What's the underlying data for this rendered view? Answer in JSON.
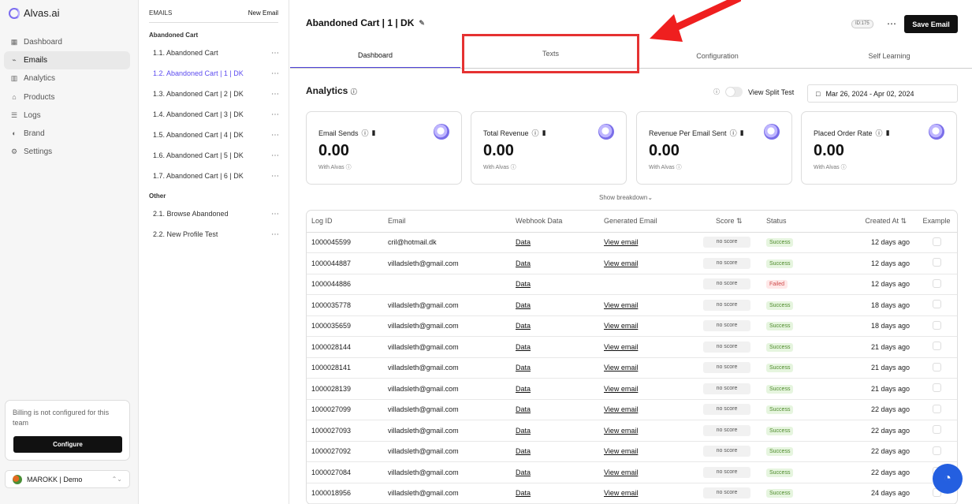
{
  "app": {
    "name": "Alvas.ai"
  },
  "sidebar": {
    "items": [
      {
        "label": "Dashboard",
        "icon": "dashboard-icon"
      },
      {
        "label": "Emails",
        "icon": "emails-icon",
        "active": true
      },
      {
        "label": "Analytics",
        "icon": "analytics-icon"
      },
      {
        "label": "Products",
        "icon": "products-icon"
      },
      {
        "label": "Logs",
        "icon": "logs-icon"
      },
      {
        "label": "Brand",
        "icon": "brand-icon"
      },
      {
        "label": "Settings",
        "icon": "settings-icon"
      }
    ],
    "billing_text": "Billing is not configured for this team",
    "configure_label": "Configure",
    "team": "MAROKK | Demo"
  },
  "emails_panel": {
    "title": "EMAILS",
    "new_label": "New Email",
    "groups": [
      {
        "label": "Abandoned Cart"
      },
      {
        "label": "Other"
      }
    ],
    "items": [
      "1.1. Abandoned Cart",
      "1.2. Abandoned Cart | 1 | DK",
      "1.3. Abandoned Cart | 2 | DK",
      "1.4. Abandoned Cart | 3 | DK",
      "1.5. Abandoned Cart | 4 | DK",
      "1.6. Abandoned Cart | 5 | DK",
      "1.7. Abandoned Cart | 6 | DK",
      "2.1. Browse Abandoned",
      "2.2. New Profile Test"
    ]
  },
  "main": {
    "title": "Abandoned Cart | 1 | DK",
    "id_badge": "ID:175",
    "save_label": "Save Email",
    "tabs": [
      "Dashboard",
      "Texts",
      "Configuration",
      "Self Learning"
    ],
    "analytics_title": "Analytics",
    "split_label": "View Split Test",
    "date_range": "Mar 26, 2024 - Apr 02, 2024",
    "cards": [
      {
        "label": "Email Sends",
        "value": "0.00",
        "sub": "With Alvas"
      },
      {
        "label": "Total Revenue",
        "value": "0.00",
        "sub": "With Alvas"
      },
      {
        "label": "Revenue Per Email Sent",
        "value": "0.00",
        "sub": "With Alvas"
      },
      {
        "label": "Placed Order Rate",
        "value": "0.00",
        "sub": "With Alvas"
      }
    ],
    "breakdown": "Show breakdown",
    "table": {
      "headers": [
        "Log ID",
        "Email",
        "Webhook Data",
        "Generated Email",
        "Score",
        "Status",
        "Created At",
        "Example"
      ],
      "rows": [
        [
          "1000045599",
          "cril@hotmail.dk",
          "Data",
          "View email",
          "no score",
          "Success",
          "12 days ago"
        ],
        [
          "1000044887",
          "villadsleth@gmail.com",
          "Data",
          "View email",
          "no score",
          "Success",
          "12 days ago"
        ],
        [
          "1000044886",
          "",
          "Data",
          "",
          "no score",
          "Failed",
          "12 days ago"
        ],
        [
          "1000035778",
          "villadsleth@gmail.com",
          "Data",
          "View email",
          "no score",
          "Success",
          "18 days ago"
        ],
        [
          "1000035659",
          "villadsleth@gmail.com",
          "Data",
          "View email",
          "no score",
          "Success",
          "18 days ago"
        ],
        [
          "1000028144",
          "villadsleth@gmail.com",
          "Data",
          "View email",
          "no score",
          "Success",
          "21 days ago"
        ],
        [
          "1000028141",
          "villadsleth@gmail.com",
          "Data",
          "View email",
          "no score",
          "Success",
          "21 days ago"
        ],
        [
          "1000028139",
          "villadsleth@gmail.com",
          "Data",
          "View email",
          "no score",
          "Success",
          "21 days ago"
        ],
        [
          "1000027099",
          "villadsleth@gmail.com",
          "Data",
          "View email",
          "no score",
          "Success",
          "22 days ago"
        ],
        [
          "1000027093",
          "villadsleth@gmail.com",
          "Data",
          "View email",
          "no score",
          "Success",
          "22 days ago"
        ],
        [
          "1000027092",
          "villadsleth@gmail.com",
          "Data",
          "View email",
          "no score",
          "Success",
          "22 days ago"
        ],
        [
          "1000027084",
          "villadsleth@gmail.com",
          "Data",
          "View email",
          "no score",
          "Success",
          "22 days ago"
        ],
        [
          "1000018956",
          "villadsleth@gmail.com",
          "Data",
          "View email",
          "no score",
          "Success",
          "24 days ago"
        ]
      ]
    }
  }
}
